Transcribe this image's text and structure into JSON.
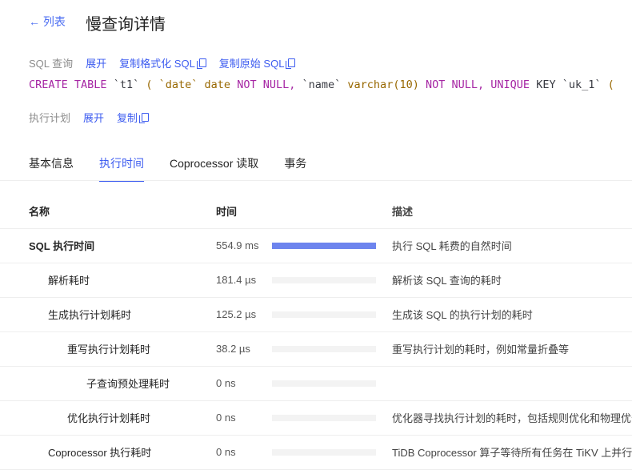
{
  "header": {
    "back": "← 列表",
    "title": "慢查询详情"
  },
  "sql": {
    "label": "SQL 查询",
    "expand": "展开",
    "copy_formatted": "复制格式化 SQL",
    "copy_raw": "复制原始 SQL",
    "tokens": [
      [
        "kw",
        "CREATE TABLE"
      ],
      [
        "",
        "`t1`"
      ],
      [
        "br",
        "("
      ],
      [
        "br",
        "`date`"
      ],
      [
        "br",
        "date"
      ],
      [
        "kw",
        "NOT NULL,"
      ],
      [
        "",
        "`name`"
      ],
      [
        "br",
        "varchar(10)"
      ],
      [
        "kw",
        "NOT NULL,"
      ],
      [
        "kw",
        "UNIQUE"
      ],
      [
        "",
        "KEY"
      ],
      [
        "",
        "`uk_1`"
      ],
      [
        "br",
        "("
      ]
    ]
  },
  "plan": {
    "label": "执行计划",
    "expand": "展开",
    "copy": "复制"
  },
  "tabs": [
    {
      "label": "基本信息"
    },
    {
      "label": "执行时间"
    },
    {
      "label": "Coprocessor 读取"
    },
    {
      "label": "事务"
    }
  ],
  "table": {
    "headers": [
      "名称",
      "时间",
      "描述"
    ],
    "rows": [
      {
        "name": "SQL 执行时间",
        "indent": 0,
        "bold": true,
        "time": "554.9 ms",
        "fraction": 1.0,
        "desc": "执行 SQL 耗费的自然时间"
      },
      {
        "name": "解析耗时",
        "indent": 1,
        "time": "181.4 µs",
        "fraction": 0.0003,
        "desc": "解析该 SQL 查询的耗时"
      },
      {
        "name": "生成执行计划耗时",
        "indent": 1,
        "time": "125.2 µs",
        "fraction": 0.0002,
        "desc": "生成该 SQL 的执行计划的耗时"
      },
      {
        "name": "重写执行计划耗时",
        "indent": 2,
        "time": "38.2 µs",
        "fraction": 0.0001,
        "desc": "重写执行计划的耗时，例如常量折叠等"
      },
      {
        "name": "子查询预处理耗时",
        "indent": 3,
        "time": "0 ns",
        "fraction": 0,
        "desc": ""
      },
      {
        "name": "优化执行计划耗时",
        "indent": 2,
        "time": "0 ns",
        "fraction": 0,
        "desc": "优化器寻找执行计划的耗时，包括规则优化和物理优化"
      },
      {
        "name": "Coprocessor 执行耗时",
        "indent": 1,
        "time": "0 ns",
        "fraction": 0,
        "desc": "TiDB Coprocessor 算子等待所有任务在 TiKV 上并行执行"
      }
    ]
  }
}
